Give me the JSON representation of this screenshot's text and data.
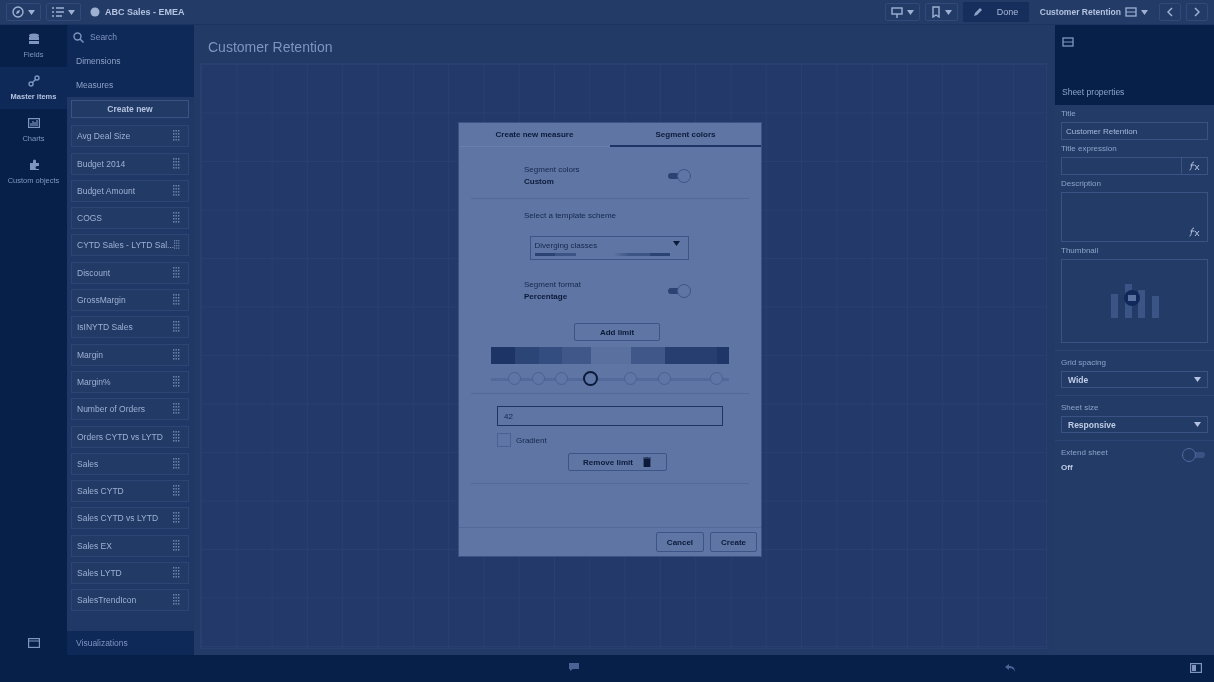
{
  "toolbar": {
    "app_title": "ABC Sales - EMEA",
    "edit_button": "Done",
    "sheet_name": "Customer Retention"
  },
  "rail": [
    {
      "label": "Fields",
      "selected": false
    },
    {
      "label": "Master items",
      "selected": true
    },
    {
      "label": "Charts",
      "selected": false
    },
    {
      "label": "Custom objects",
      "selected": false
    }
  ],
  "panel": {
    "search": {
      "placeholder": "Search"
    },
    "sections": [
      "Dimensions",
      "Measures"
    ],
    "create_button": "Create new",
    "measures": [
      "Avg Deal Size",
      "Budget 2014",
      "Budget Amount",
      "COGS",
      "CYTD Sales - LYTD Sal...",
      "Discount",
      "GrossMargin",
      "IsINYTD Sales",
      "Margin",
      "Margin%",
      "Number of Orders",
      "Orders CYTD vs LYTD",
      "Sales",
      "Sales CYTD",
      "Sales CYTD vs LYTD",
      "Sales EX",
      "Sales LYTD",
      "SalesTrendIcon"
    ],
    "footer": "Visualizations"
  },
  "sheet": {
    "title": "Customer Retention"
  },
  "dialog": {
    "tabs": [
      {
        "label": "Create new measure",
        "selected": false
      },
      {
        "label": "Segment colors",
        "selected": true
      }
    ],
    "segment_colors": {
      "label": "Segment colors",
      "value": "Custom",
      "on": true
    },
    "template_label": "Select a template scheme",
    "template": {
      "value": "Diverging classes"
    },
    "segment_format": {
      "label": "Segment format",
      "value": "Percentage",
      "on": true
    },
    "add_limit": "Add limit",
    "segments": [
      {
        "color": "#1d3566"
      },
      {
        "color": "#2c4577"
      },
      {
        "color": "#344d80"
      },
      {
        "color": "#3f5889"
      },
      {
        "color": "#5a71a0"
      },
      {
        "color": "#3f5889"
      },
      {
        "color": "#263e70"
      },
      {
        "color": "#1f3768"
      }
    ],
    "limits": [
      {
        "level": 0.1,
        "selected": false
      },
      {
        "level": 0.2,
        "selected": false
      },
      {
        "level": 0.3,
        "selected": false
      },
      {
        "level": 0.42,
        "selected": true
      },
      {
        "level": 0.59,
        "selected": false
      },
      {
        "level": 0.73,
        "selected": false
      },
      {
        "level": 0.95,
        "selected": false
      }
    ],
    "limit_value": "42",
    "gradient": {
      "label": "Gradient",
      "checked": false
    },
    "remove_limit": "Remove limit",
    "buttons": [
      "Cancel",
      "Create"
    ]
  },
  "properties": {
    "header": "Sheet properties",
    "title_label": "Title",
    "title_value": "Customer Retention",
    "expression_label": "Title expression",
    "description_label": "Description",
    "thumbnail_label": "Thumbnail",
    "grid_label": "Grid spacing",
    "grid_value": "Wide",
    "size_label": "Sheet size",
    "size_value": "Responsive",
    "extend": {
      "label": "Extend sheet",
      "value": "Off",
      "on": false
    }
  }
}
